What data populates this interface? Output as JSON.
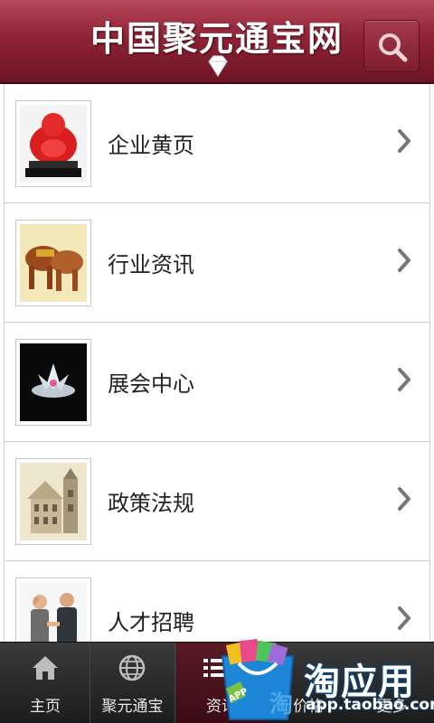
{
  "header": {
    "title": "中国聚元通宝网"
  },
  "list": {
    "items": [
      {
        "label": "企业黄页",
        "thumb": "buddha-statue"
      },
      {
        "label": "行业资讯",
        "thumb": "carved-elephants"
      },
      {
        "label": "展会中心",
        "thumb": "crystal-lotus"
      },
      {
        "label": "政策法规",
        "thumb": "building-sketch"
      },
      {
        "label": "人才招聘",
        "thumb": "handshake-people"
      }
    ]
  },
  "tabbar": {
    "tabs": [
      {
        "label": "主页",
        "icon": "home-icon"
      },
      {
        "label": "聚元通宝",
        "icon": "globe-icon"
      },
      {
        "label": "资讯",
        "icon": "list-icon",
        "active": true
      },
      {
        "label": "价格",
        "icon": "tag-icon"
      },
      {
        "label": "更多",
        "icon": "more-icon"
      }
    ]
  },
  "watermark": {
    "name": "淘应用",
    "url": "app.taobao.com",
    "badge": "APP"
  },
  "colors": {
    "header": "#8e2436",
    "active_tab": "#5a1a24",
    "watermark_blue": "#1e86d6"
  }
}
